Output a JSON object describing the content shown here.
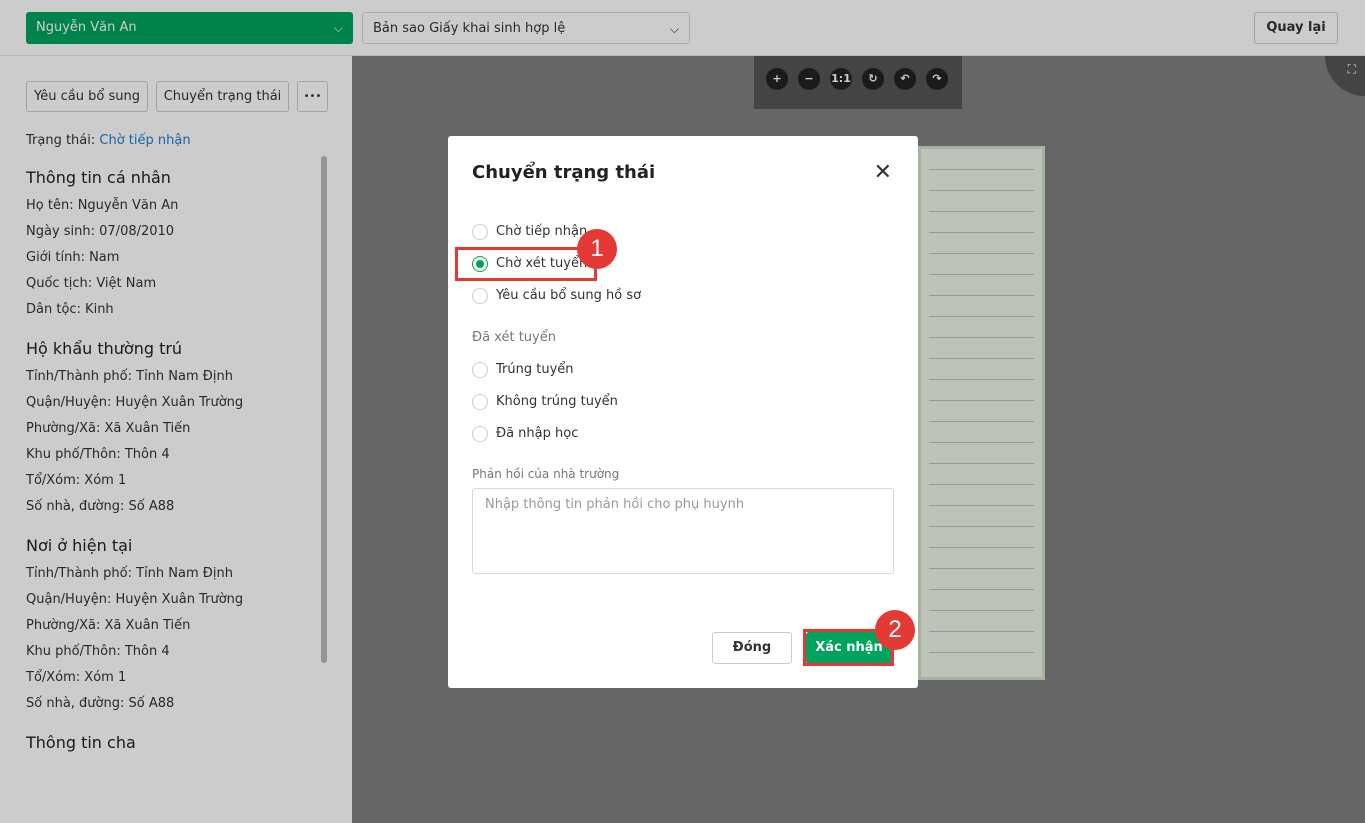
{
  "header": {
    "student_select": "Nguyễn Văn An",
    "document_select": "Bản sao Giấy khai sinh hợp lệ",
    "back_label": "Quay lại"
  },
  "left": {
    "btn_request": "Yêu cầu bổ sung",
    "btn_change_status": "Chuyển trạng thái",
    "btn_more": "•••",
    "status_label": "Trạng thái: ",
    "status_value": "Chờ tiếp nhận",
    "sections": [
      {
        "title": "Thông tin cá nhân",
        "rows": [
          "Họ tên: Nguyễn Văn An",
          "Ngày sinh: 07/08/2010",
          "Giới tính: Nam",
          "Quốc tịch: Việt Nam",
          "Dân tộc: Kinh"
        ]
      },
      {
        "title": "Hộ khẩu thường trú",
        "rows": [
          "Tỉnh/Thành phố: Tỉnh Nam Định",
          "Quận/Huyện: Huyện Xuân Trường",
          "Phường/Xã: Xã Xuân Tiến",
          "Khu phố/Thôn: Thôn 4",
          "Tổ/Xóm: Xóm 1",
          "Số nhà, đường: Số A88"
        ]
      },
      {
        "title": "Nơi ở hiện tại",
        "rows": [
          "Tỉnh/Thành phố: Tỉnh Nam Định",
          "Quận/Huyện: Huyện Xuân Trường",
          "Phường/Xã: Xã Xuân Tiến",
          "Khu phố/Thôn: Thôn 4",
          "Tổ/Xóm: Xóm 1",
          "Số nhà, đường: Số A88"
        ]
      },
      {
        "title": "Thông tin cha",
        "rows": []
      }
    ]
  },
  "viewer": {
    "tools": [
      "+",
      "−",
      "1:1",
      "↻",
      "↶",
      "↷"
    ],
    "fullscreen": "⛶"
  },
  "modal": {
    "title": "Chuyển trạng thái",
    "close": "✕",
    "options": [
      "Chờ tiếp nhận",
      "Chờ xét tuyển",
      "Yêu cầu bổ sung hồ sơ"
    ],
    "group_label": "Đã xét tuyển",
    "group_options": [
      "Trúng tuyển",
      "Không trúng tuyển",
      "Đã nhập học"
    ],
    "selected": "Chờ xét tuyển",
    "feedback_label": "Phản hồi của nhà trường",
    "feedback_placeholder": "Nhập thông tin phản hồi cho phụ huynh",
    "btn_close": "Đóng",
    "btn_confirm": "Xác nhận"
  },
  "annotations": {
    "step1": "1",
    "step2": "2",
    "color": "#e53935"
  },
  "colors": {
    "accent": "#00a35e",
    "link": "#1a7fd1"
  }
}
